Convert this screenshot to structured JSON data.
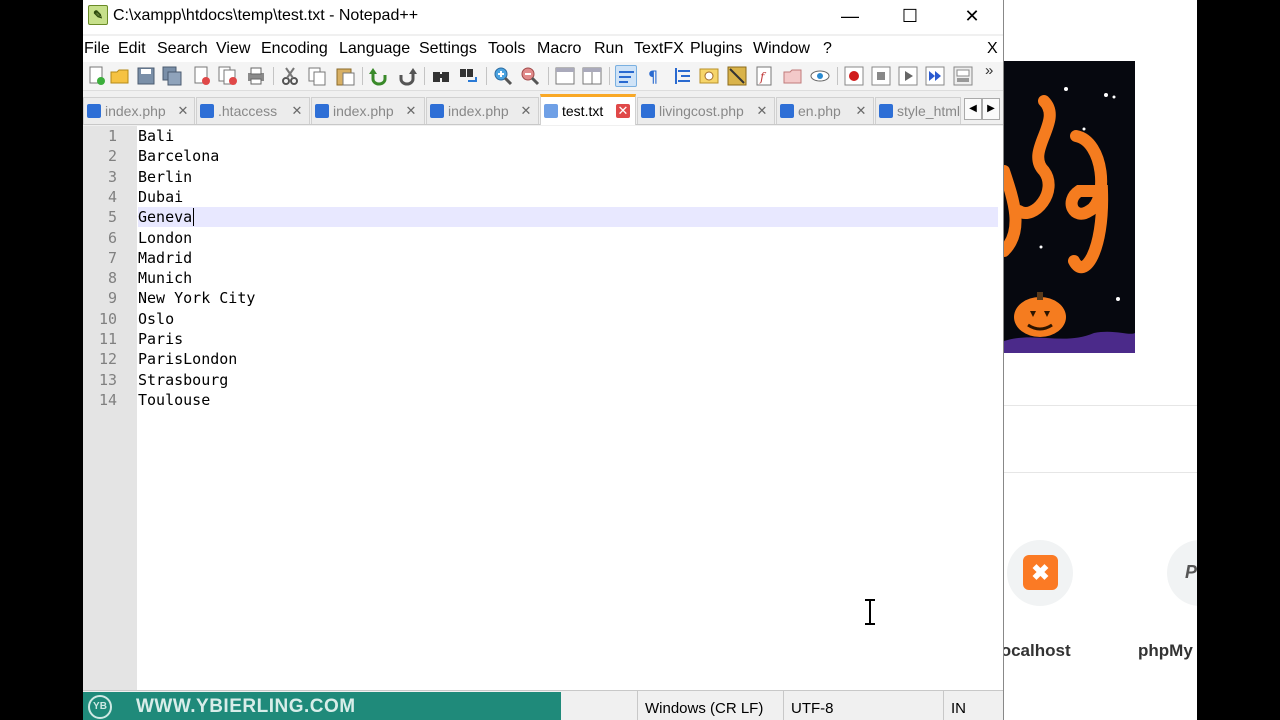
{
  "window": {
    "title": "C:\\xampp\\htdocs\\temp\\test.txt - Notepad++",
    "minimize_glyph": "—",
    "maximize_glyph": "☐",
    "close_glyph": "✕"
  },
  "menu": {
    "items": [
      "File",
      "Edit",
      "Search",
      "View",
      "Encoding",
      "Language",
      "Settings",
      "Tools",
      "Macro",
      "Run",
      "TextFX",
      "Plugins",
      "Window",
      "?"
    ],
    "close_label": "X"
  },
  "toolbar": {
    "overflow_glyph": "»",
    "icons": [
      "new-file-icon",
      "open-file-icon",
      "save-icon",
      "save-all-icon",
      "close-icon",
      "close-all-icon",
      "print-icon",
      "cut-icon",
      "copy-icon",
      "paste-icon",
      "undo-icon",
      "redo-icon",
      "find-icon",
      "replace-icon",
      "zoom-in-icon",
      "zoom-out-icon",
      "sync-vertical-icon",
      "sync-horizontal-icon",
      "word-wrap-icon",
      "show-all-chars-icon",
      "indent-guide-icon",
      "define-language-icon",
      "document-map-icon",
      "function-list-icon",
      "folder-workspace-icon",
      "monitoring-icon",
      "record-macro-icon",
      "stop-macro-icon",
      "play-macro-icon",
      "run-macro-multiple-icon",
      "save-macro-icon"
    ]
  },
  "tabs": [
    {
      "label": "index.php",
      "active": false
    },
    {
      "label": ".htaccess",
      "active": false
    },
    {
      "label": "index.php",
      "active": false
    },
    {
      "label": "index.php",
      "active": false
    },
    {
      "label": "test.txt",
      "active": true
    },
    {
      "label": "livingcost.php",
      "active": false
    },
    {
      "label": "en.php",
      "active": false
    },
    {
      "label": "style_html",
      "active": false
    }
  ],
  "tab_scroll": {
    "left": "◀",
    "right": "▶"
  },
  "editor": {
    "lines": [
      "Bali",
      "Barcelona",
      "Berlin",
      "Dubai",
      "Geneva",
      "London",
      "Madrid",
      "Munich",
      "New York City",
      "Oslo",
      "Paris",
      "ParisLondon",
      "Strasbourg",
      "Toulouse"
    ],
    "current_line": 5
  },
  "statusbar": {
    "eol": "Windows (CR LF)",
    "encoding": "UTF-8",
    "mode": "IN"
  },
  "watermark": {
    "logo": "YB",
    "text": "WWW.YBIERLING.COM"
  },
  "browser": {
    "shortcuts": [
      {
        "label": "localhost",
        "icon": "xampp-icon"
      },
      {
        "label": "phpMy",
        "icon": "phpmyadmin-icon"
      }
    ]
  },
  "colors": {
    "accent_tab": "#f9a825",
    "current_line_bg": "#e8e8ff",
    "watermark_bg": "#1f8a7a",
    "xampp_orange": "#fb7a24"
  }
}
